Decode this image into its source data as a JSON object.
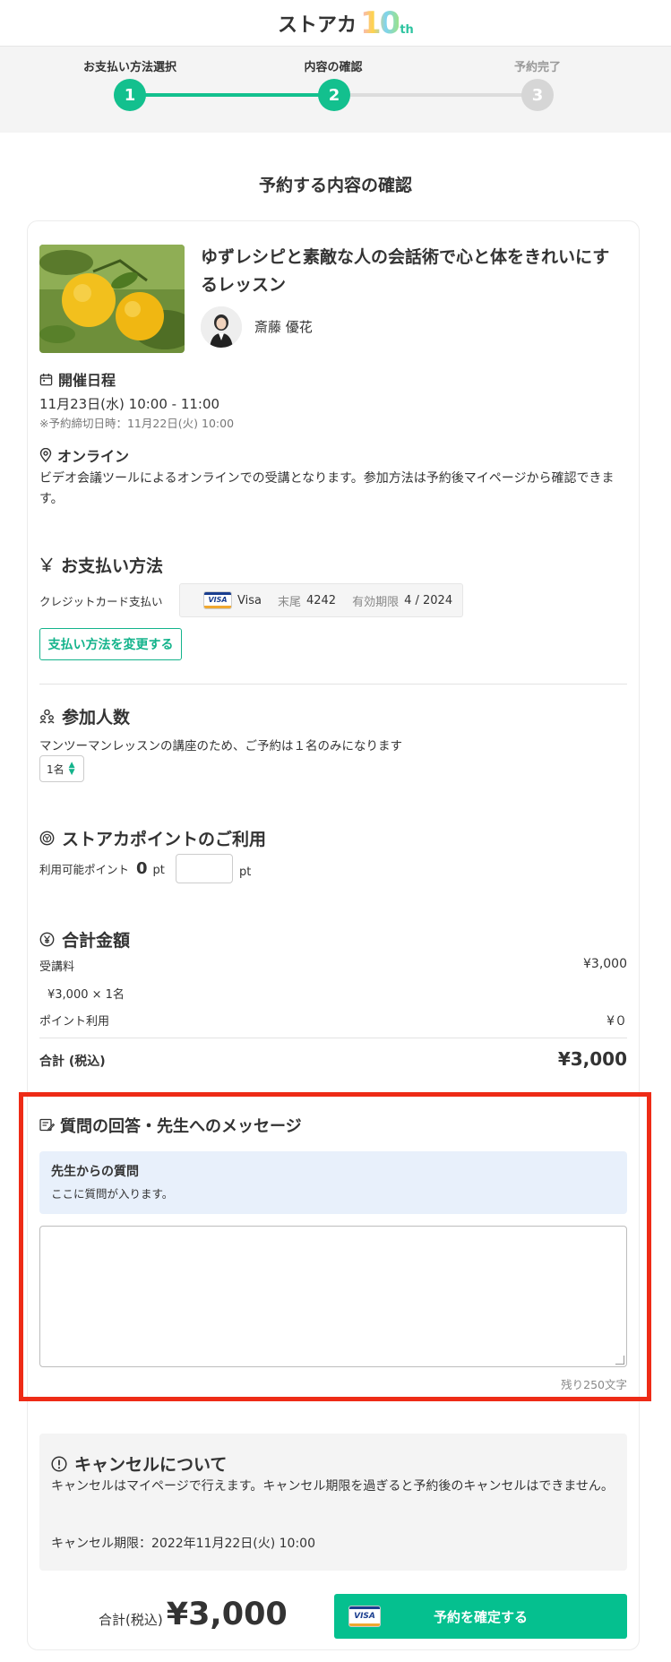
{
  "header": {
    "logo_text": "ストアカ",
    "logo_ten": "10",
    "logo_th": "th"
  },
  "stepper": {
    "steps": [
      {
        "label": "お支払い方法選択",
        "number": "1",
        "state": "done"
      },
      {
        "label": "内容の確認",
        "number": "2",
        "state": "current"
      },
      {
        "label": "予約完了",
        "number": "3",
        "state": "pending"
      }
    ],
    "accent_color": "#13c08e"
  },
  "page_title": "予約する内容の確認",
  "lesson": {
    "title": "ゆずレシピと素敵な人の会話術で心と体をきれいにするレッスン",
    "teacher_name": "斎藤 優花"
  },
  "schedule": {
    "heading": "開催日程",
    "datetime": "11月23日(水) 10:00 - 11:00",
    "deadline": "※予約締切日時：11月22日(火) 10:00"
  },
  "location": {
    "heading": "オンライン",
    "description": "ビデオ会議ツールによるオンラインでの受講となります。参加方法は予約後マイページから確認できます。"
  },
  "payment": {
    "heading": "お支払い方法",
    "method_label": "クレジットカード支払い",
    "card_brand": "Visa",
    "last4_label": "末尾",
    "last4": "4242",
    "expiry_label": "有効期限",
    "expiry": "4 / 2024",
    "change_button": "支払い方法を変更する"
  },
  "participants": {
    "heading": "参加人数",
    "note": "マンツーマンレッスンの講座のため、ご予約は１名のみになります",
    "selected": "1名"
  },
  "points": {
    "heading": "ストアカポイントのご利用",
    "available_label": "利用可能ポイント",
    "available_value": "0",
    "unit": "pt",
    "input_value": "",
    "input_unit": "pt"
  },
  "total": {
    "heading": "合計金額",
    "fee_label": "受講料",
    "fee_value": "¥3,000",
    "fee_detail": "¥3,000 × 1名",
    "point_label": "ポイント利用",
    "point_value": "¥０",
    "total_label": "合計 (税込)",
    "total_value": "¥3,000"
  },
  "message": {
    "heading": "質問の回答・先生へのメッセージ",
    "question_title": "先生からの質問",
    "question_body": "ここに質問が入ります。",
    "textarea_value": "",
    "remaining": "残り250文字"
  },
  "cancel": {
    "heading": "キャンセルについて",
    "body": "キャンセルはマイページで行えます。キャンセル期限を過ぎると予約後のキャンセルはできません。",
    "deadline": "キャンセル期限：2022年11月22日(火) 10:00"
  },
  "footer": {
    "total_label": "合計(税込)",
    "total_value": "¥3,000",
    "confirm_button": "予約を確定する",
    "card_brand_mark": "VISA"
  },
  "colors": {
    "accent": "#05c08f",
    "highlight": "#ee2b16",
    "question_bg": "#e8f0fb"
  }
}
